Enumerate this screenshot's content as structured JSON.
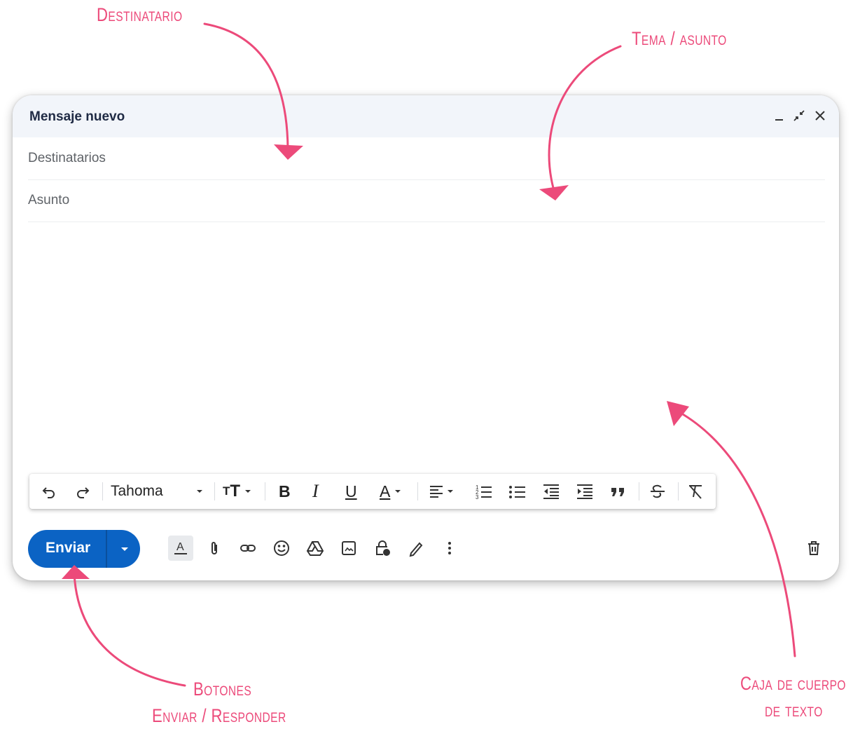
{
  "annotations": {
    "recipient": "Destinatario",
    "subject": "Tema / asunto",
    "send_line1": "Botones",
    "send_line2": "Enviar / Responder",
    "body_line1": "Caja de cuerpo",
    "body_line2": "de texto"
  },
  "compose": {
    "title": "Mensaje nuevo",
    "recipients_placeholder": "Destinatarios",
    "subject_placeholder": "Asunto",
    "font": "Tahoma",
    "send_label": "Enviar"
  },
  "icons": {
    "header": [
      "minimize-icon",
      "exit-fullscreen-icon",
      "close-icon"
    ],
    "toolbar": [
      "undo-icon",
      "redo-icon",
      "font-size-icon",
      "bold-icon",
      "italic-icon",
      "underline-icon",
      "text-color-icon",
      "align-icon",
      "numbered-list-icon",
      "bulleted-list-icon",
      "indent-less-icon",
      "indent-more-icon",
      "quote-icon",
      "strikethrough-icon",
      "remove-formatting-icon"
    ],
    "bottom": [
      "formatting-options-icon",
      "attach-icon",
      "link-icon",
      "emoji-icon",
      "drive-icon",
      "photo-icon",
      "confidential-icon",
      "signature-icon",
      "more-options-icon",
      "discard-icon"
    ]
  },
  "colors": {
    "annotation": "#ec4a7a",
    "send_button": "#0b63c4",
    "header_bg": "#f2f5fa"
  }
}
